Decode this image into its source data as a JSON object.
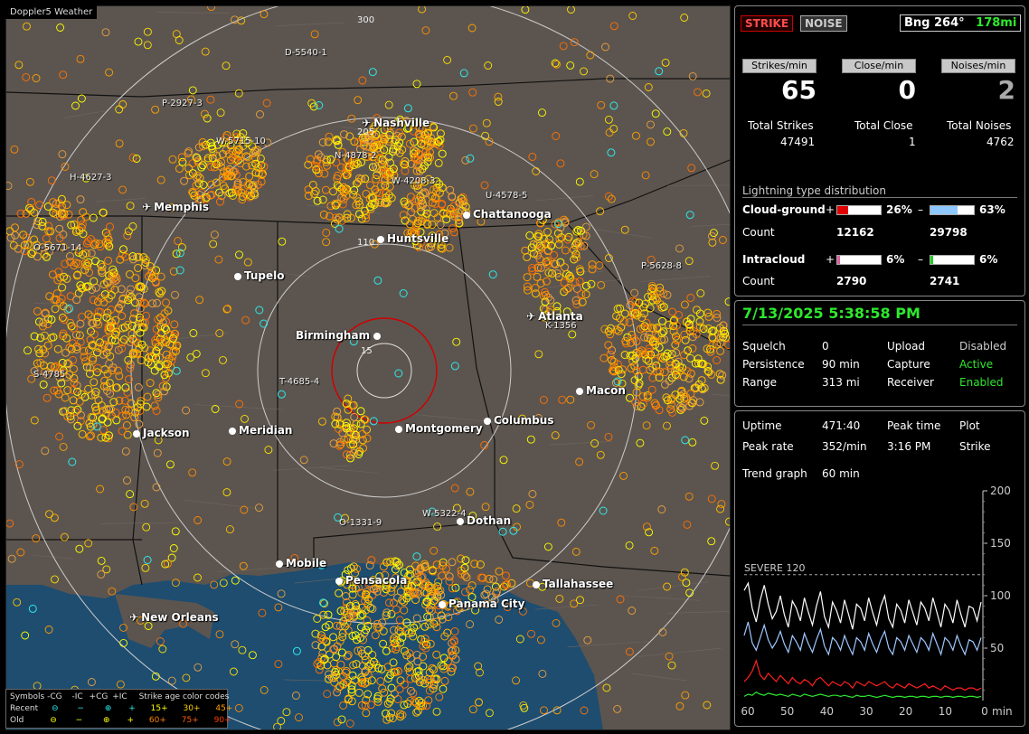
{
  "window": {
    "title": "Doppler5 Weather"
  },
  "map": {
    "range_labels": [
      "300",
      "205",
      "110",
      "15"
    ],
    "cities": [
      {
        "name": "Nashville",
        "marker": "airport"
      },
      {
        "name": "Memphis",
        "marker": "airport"
      },
      {
        "name": "Chattanooga",
        "marker": "dot"
      },
      {
        "name": "Huntsville",
        "marker": "dot"
      },
      {
        "name": "Tupelo",
        "marker": "dot"
      },
      {
        "name": "Atlanta",
        "marker": "airport"
      },
      {
        "name": "Birmingham",
        "marker": "dot"
      },
      {
        "name": "Macon",
        "marker": "dot"
      },
      {
        "name": "Jackson",
        "marker": "dot"
      },
      {
        "name": "Meridian",
        "marker": "dot"
      },
      {
        "name": "Montgomery",
        "marker": "dot"
      },
      {
        "name": "Columbus",
        "marker": "dot"
      },
      {
        "name": "Dothan",
        "marker": "dot"
      },
      {
        "name": "Mobile",
        "marker": "dot"
      },
      {
        "name": "Pensacola",
        "marker": "dot"
      },
      {
        "name": "Tallahassee",
        "marker": "dot"
      },
      {
        "name": "Panama City",
        "marker": "dot"
      },
      {
        "name": "New Orleans",
        "marker": "airport"
      }
    ],
    "storm_labels": [
      "D-5540-1",
      "P-2927-3",
      "W-5715-10",
      "N-4878-2",
      "H-4627-3",
      "W-4208-3",
      "U-4578-5",
      "O-5671-14",
      "P-5628-8",
      "K-1356",
      "S-4785",
      "T-4685-4",
      "O-1331-9",
      "W-5322-4"
    ],
    "legend": {
      "title_symbols": "Symbols",
      "headers": [
        "-CG",
        "-IC",
        "+CG",
        "+IC"
      ],
      "age_title": "Strike age color codes",
      "recent_label": "Recent",
      "old_label": "Old",
      "recent_ages": [
        "15+",
        "30+",
        "45+"
      ],
      "old_ages": [
        "60+",
        "75+",
        "90+"
      ]
    }
  },
  "status": {
    "strike_btn": "STRIKE",
    "noise_btn": "NOISE",
    "bearing": "Bng 264°",
    "distance": "178mi",
    "strikes_hdr": "Strikes/min",
    "close_hdr": "Close/min",
    "noises_hdr": "Noises/min",
    "strikes_val": "65",
    "close_val": "0",
    "noises_val": "2",
    "total_strikes_lbl": "Total Strikes",
    "total_close_lbl": "Total Close",
    "total_noises_lbl": "Total Noises",
    "total_strikes": "47491",
    "total_close": "1",
    "total_noises": "4762",
    "dist_title": "Lightning type distribution",
    "cg_label": "Cloud-ground",
    "cg_pos_pct": "26%",
    "cg_neg_pct": "63%",
    "ic_label": "Intracloud",
    "ic_pos_pct": "6%",
    "ic_neg_pct": "6%",
    "count_label": "Count",
    "cg_pos_count": "12162",
    "cg_neg_count": "29798",
    "ic_pos_count": "2790",
    "ic_neg_count": "2741",
    "plus": "+",
    "minus": "–"
  },
  "bars": {
    "cg_pos": 0.26,
    "cg_neg": 0.63,
    "ic_pos": 0.06,
    "ic_neg": 0.06
  },
  "settings": {
    "datetime": "7/13/2025 5:38:58 PM",
    "squelch_lbl": "Squelch",
    "squelch": "0",
    "persist_lbl": "Persistence",
    "persist": "90 min",
    "range_lbl": "Range",
    "range": "313 mi",
    "upload_lbl": "Upload",
    "upload": "Disabled",
    "capture_lbl": "Capture",
    "capture": "Active",
    "receiver_lbl": "Receiver",
    "receiver": "Enabled"
  },
  "trend": {
    "uptime_lbl": "Uptime",
    "uptime": "471:40",
    "peaktime_lbl": "Peak time",
    "plot_lbl": "Plot",
    "peakrate_lbl": "Peak rate",
    "peakrate": "352/min",
    "peaktime": "3:16 PM",
    "plot": "Strike",
    "graph_lbl": "Trend graph",
    "graph": "60 min",
    "severe": "SEVERE 120",
    "unit": "min"
  },
  "chart_data": {
    "type": "line",
    "x_ticks": [
      "60",
      "50",
      "40",
      "30",
      "20",
      "10",
      "0"
    ],
    "y_ticks": [
      "200",
      "150",
      "100",
      "50"
    ],
    "ylim": [
      0,
      200
    ],
    "xlim": [
      60,
      0
    ],
    "threshold": 120,
    "series": [
      {
        "color": "#ffffff",
        "values": [
          105,
          112,
          88,
          75,
          96,
          110,
          92,
          78,
          85,
          100,
          82,
          70,
          95,
          88,
          76,
          98,
          84,
          72,
          90,
          104,
          80,
          70,
          94,
          86,
          74,
          96,
          82,
          68,
          92,
          88,
          76,
          98,
          84,
          72,
          90,
          100,
          78,
          70,
          92,
          86,
          74,
          96,
          84,
          72,
          94,
          88,
          76,
          98,
          84,
          70,
          92,
          86,
          74,
          96,
          82,
          70,
          90,
          88,
          76,
          94
        ]
      },
      {
        "color": "#9fc8ff",
        "values": [
          62,
          75,
          55,
          48,
          60,
          72,
          58,
          50,
          56,
          66,
          54,
          46,
          62,
          56,
          48,
          64,
          54,
          46,
          58,
          68,
          52,
          44,
          60,
          56,
          48,
          62,
          52,
          44,
          60,
          56,
          48,
          64,
          54,
          46,
          58,
          66,
          50,
          44,
          60,
          56,
          48,
          62,
          54,
          46,
          60,
          56,
          48,
          64,
          54,
          44,
          60,
          56,
          48,
          62,
          52,
          44,
          58,
          56,
          48,
          60
        ]
      },
      {
        "color": "#ff2020",
        "values": [
          18,
          22,
          28,
          38,
          24,
          20,
          26,
          22,
          18,
          24,
          20,
          16,
          22,
          18,
          16,
          20,
          18,
          14,
          20,
          22,
          18,
          14,
          18,
          16,
          14,
          18,
          16,
          12,
          18,
          16,
          14,
          18,
          16,
          14,
          16,
          18,
          14,
          12,
          16,
          14,
          12,
          16,
          14,
          12,
          14,
          16,
          12,
          14,
          12,
          10,
          14,
          12,
          10,
          12,
          12,
          10,
          12,
          12,
          10,
          12
        ]
      },
      {
        "color": "#2ee82e",
        "values": [
          4,
          6,
          5,
          8,
          6,
          5,
          7,
          6,
          5,
          6,
          5,
          4,
          6,
          5,
          4,
          6,
          5,
          4,
          5,
          6,
          5,
          4,
          5,
          5,
          4,
          5,
          4,
          3,
          5,
          4,
          4,
          5,
          4,
          3,
          4,
          5,
          4,
          3,
          4,
          4,
          3,
          4,
          4,
          3,
          4,
          4,
          3,
          4,
          4,
          3,
          4,
          4,
          3,
          4,
          4,
          3,
          4,
          4,
          3,
          4
        ]
      }
    ]
  }
}
